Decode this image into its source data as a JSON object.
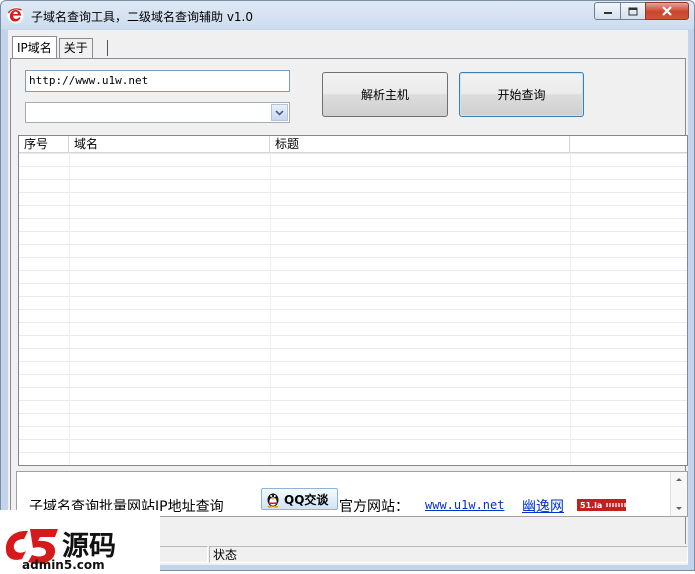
{
  "window": {
    "title": "子域名查询工具，二级域名查询辅助 v1.0",
    "controls": [
      "minimize-icon",
      "maximize-icon",
      "close-icon"
    ]
  },
  "tabs": [
    {
      "label": "IP域名",
      "active": true
    },
    {
      "label": "关于",
      "active": false
    }
  ],
  "form": {
    "url_value": "http://www.u1w.net",
    "combo_value": "",
    "resolve_button": "解析主机",
    "query_button": "开始查询"
  },
  "list": {
    "columns": [
      "序号",
      "域名",
      "标题"
    ],
    "rows": []
  },
  "footer": {
    "description": "子域名查询批量网站IP地址查询",
    "qq_button": "QQ交谈",
    "site_label": "官方网站：",
    "site_link": "www.u1w.net",
    "brand_link": "幽逸网",
    "badge_text": "51.la"
  },
  "statusbar": {
    "status_label": "状态"
  },
  "watermark": {
    "brand": "a5源码",
    "site": "admin5.com"
  },
  "colors": {
    "accent_link": "#0033cc",
    "close_button": "#c8452c",
    "badge": "#c21f1f",
    "watermark_red": "#d7191b"
  }
}
